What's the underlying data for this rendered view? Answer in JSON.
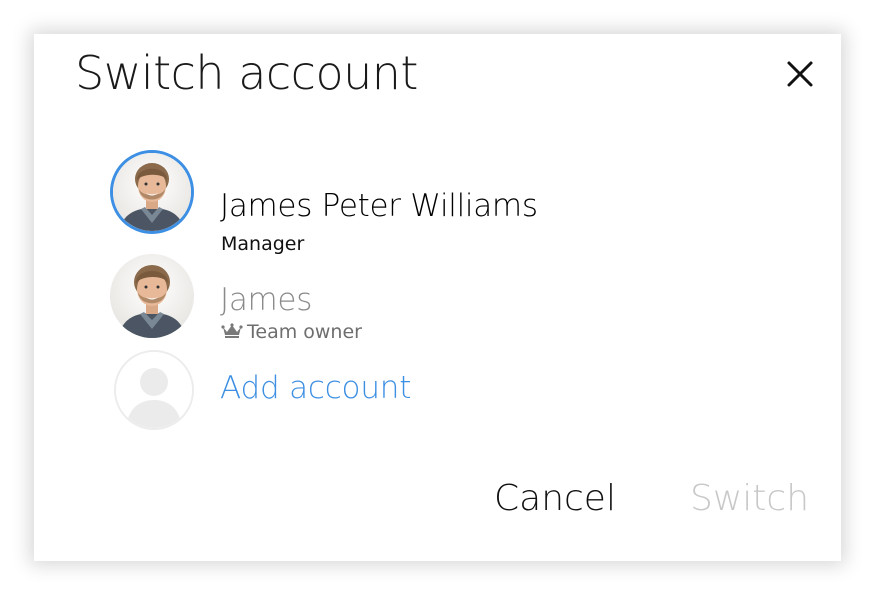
{
  "dialog": {
    "title": "Switch account",
    "close_icon": "close-icon"
  },
  "accounts": [
    {
      "name": "James Peter Williams",
      "role": "Manager",
      "selected": true,
      "name_color": "#1a1a1a",
      "role_color": "#111111"
    },
    {
      "name": "James",
      "role": "Team owner",
      "role_icon": "crown-icon",
      "selected": false,
      "name_color": "#8a8a8a",
      "role_color": "#6e6e6e"
    }
  ],
  "add_account": {
    "label": "Add account",
    "icon": "person-placeholder-icon"
  },
  "actions": {
    "cancel_label": "Cancel",
    "switch_label": "Switch",
    "switch_enabled": false
  },
  "colors": {
    "accent": "#3d8fe3",
    "disabled": "#c8c8c8"
  }
}
